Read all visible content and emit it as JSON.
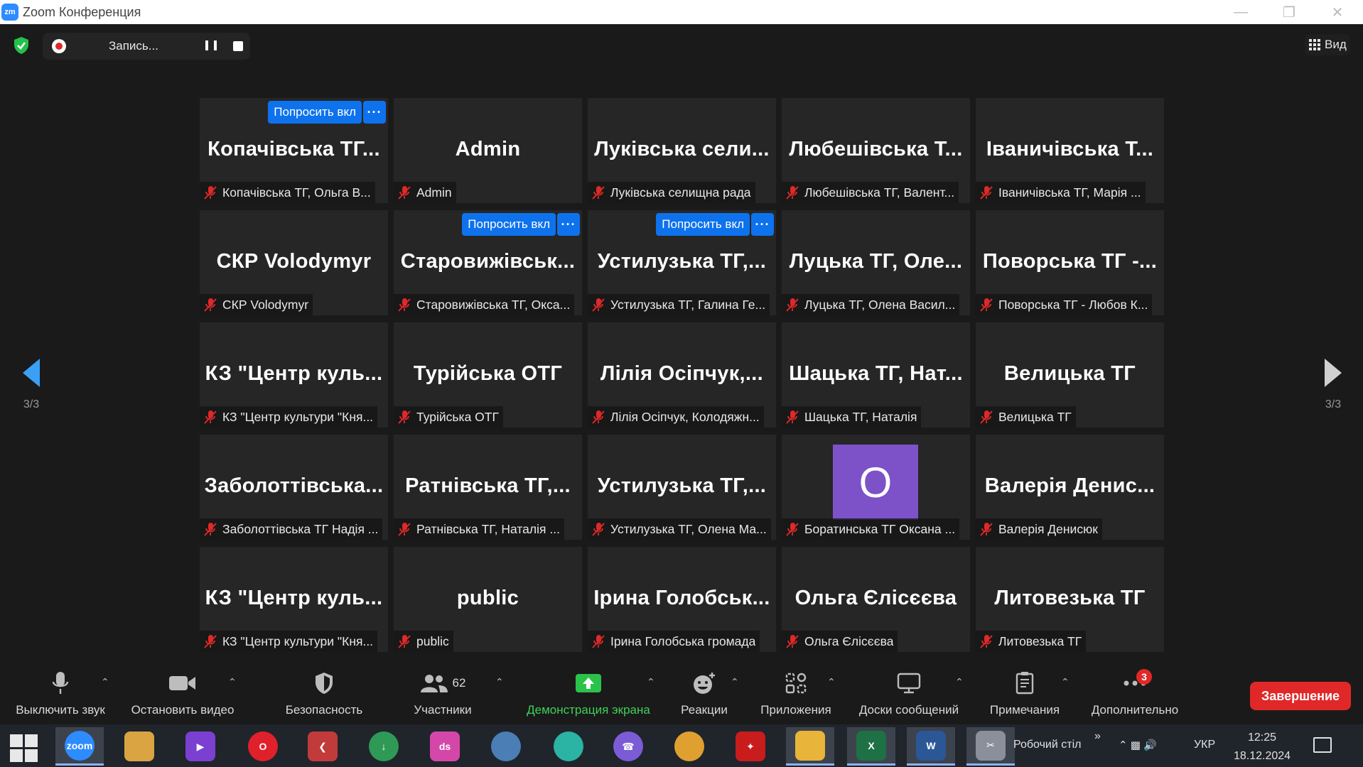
{
  "window": {
    "title": "Zoom Конференция"
  },
  "recording": {
    "label": "Запись..."
  },
  "view_button": {
    "label": "Вид"
  },
  "navigation": {
    "left_page": "3/3",
    "right_page": "3/3"
  },
  "tile_actions": {
    "ask_unmute_label": "Попросить вкл",
    "more_label": "···"
  },
  "tiles": [
    {
      "title": "Копачівська ТГ...",
      "name": "Копачівська ТГ, Ольга В..."
    },
    {
      "title": "Admin",
      "name": "Admin"
    },
    {
      "title": "Луківська сели...",
      "name": "Луківська селищна рада"
    },
    {
      "title": "Любешівська Т...",
      "name": "Любешівська ТГ, Валент..."
    },
    {
      "title": "Іваничівська Т...",
      "name": "Іваничівська ТГ, Марія ..."
    },
    {
      "title": "СКР Volodymyr",
      "name": "СКР Volodymyr"
    },
    {
      "title": "Старовижівськ...",
      "name": "Старовижівська ТГ, Окса..."
    },
    {
      "title": "Устилузька ТГ,...",
      "name": "Устилузька ТГ, Галина Ге..."
    },
    {
      "title": "Луцька ТГ, Оле...",
      "name": "Луцька ТГ, Олена Васил..."
    },
    {
      "title": "Поворська ТГ -...",
      "name": "Поворська ТГ - Любов К..."
    },
    {
      "title": "КЗ \"Центр куль...",
      "name": "КЗ \"Центр культури \"Кня..."
    },
    {
      "title": "Турійська ОТГ",
      "name": "Турійська ОТГ"
    },
    {
      "title": "Лілія Осіпчук,...",
      "name": "Лілія Осіпчук, Колодяжн..."
    },
    {
      "title": "Шацька ТГ, Нат...",
      "name": "Шацька ТГ, Наталія"
    },
    {
      "title": "Велицька ТГ",
      "name": "Велицька ТГ"
    },
    {
      "title": "Заболоттівська...",
      "name": "Заболоттівська ТГ Надія ..."
    },
    {
      "title": "Ратнівська ТГ,...",
      "name": "Ратнівська ТГ, Наталія ..."
    },
    {
      "title": "Устилузька ТГ,...",
      "name": "Устилузька ТГ, Олена Ма..."
    },
    {
      "title": "",
      "avatar": "О",
      "name": "Боратинська ТГ Оксана ..."
    },
    {
      "title": "Валерія Денис...",
      "name": "Валерія Денисюк"
    },
    {
      "title": "КЗ \"Центр куль...",
      "name": "КЗ \"Центр культури \"Кня..."
    },
    {
      "title": "public",
      "name": "public"
    },
    {
      "title": "Ірина Голобськ...",
      "name": "Ірина Голобська громада"
    },
    {
      "title": "Ольга Єлісєєва",
      "name": "Ольга Єлісєєва"
    },
    {
      "title": "Литовезька ТГ",
      "name": "Литовезька ТГ"
    }
  ],
  "toolbar": {
    "mute": "Выключить звук",
    "video": "Остановить видео",
    "security": "Безопасность",
    "participants": "Участники",
    "participants_count": "62",
    "share": "Демонстрация экрана",
    "reactions": "Реакции",
    "apps": "Приложения",
    "whiteboards": "Доски сообщений",
    "notes": "Примечания",
    "more": "Дополнительно",
    "more_badge": "3",
    "end": "Завершение"
  },
  "colors": {
    "accent_blue": "#0e72ed",
    "share_green": "#3fd15a",
    "end_red": "#e02828",
    "avatar_purple": "#7d52c8",
    "mute_red": "#e02828"
  },
  "taskbar": {
    "desktop_label": "Робочий стіл",
    "language": "УКР",
    "time": "12:25",
    "date": "18.12.2024",
    "apps": [
      "zoom-app-icon",
      "paint-app-icon",
      "media-app-icon",
      "opera-browser-icon",
      "red-app-icon",
      "download-app-icon",
      "ds-app-icon",
      "globe-app-icon",
      "teal-app-icon",
      "viber-app-icon",
      "chrome-browser-icon",
      "acrobat-app-icon",
      "file-explorer-icon",
      "excel-app-icon",
      "word-app-icon",
      "snipping-app-icon"
    ]
  }
}
